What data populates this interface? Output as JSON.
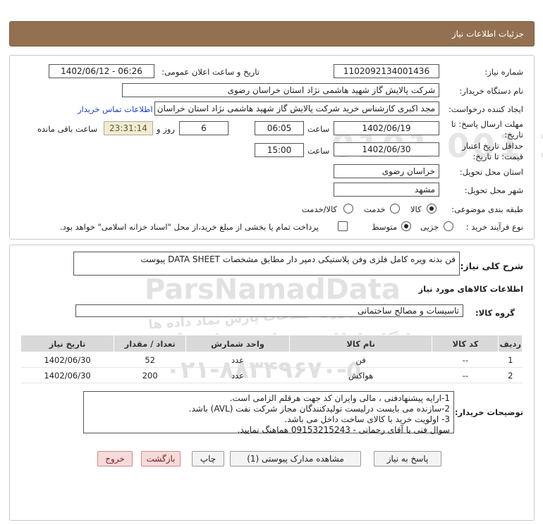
{
  "header": {
    "title": "جزئیات اطلاعات نیاز"
  },
  "need_number": {
    "label": "شماره نیاز:",
    "value": "1102092134001436"
  },
  "announce_datetime": {
    "label": "تاریخ و ساعت اعلان عمومی:",
    "value": "1402/06/12 - 06:26"
  },
  "buyer_org": {
    "label": "نام دستگاه خریدار:",
    "value": "شرکت پالایش گاز شهید هاشمی نژاد   استان خراسان رضوی"
  },
  "requester": {
    "label": "ایجاد کننده درخواست:",
    "value": "مجد اکبری کارشناس خرید شرکت پالایش گاز شهید هاشمی نژاد   استان خراسان رضوی",
    "contact_link": "اطلاعات تماس خریدار"
  },
  "reply_deadline": {
    "label_line1": "مهلت ارسال پاسخ: تا",
    "label_line2": "تاریخ:",
    "date": "1402/06/19",
    "time_label": "ساعت",
    "time": "06:05",
    "days": "6",
    "days_label": "روز و",
    "remaining": "23:31:14",
    "remaining_label": "ساعت باقی مانده"
  },
  "price_validity": {
    "label_line1": "حداقل تاریخ اعتبار",
    "label_line2": "قیمت: تا تاریخ:",
    "date": "1402/06/30",
    "time_label": "ساعت",
    "time": "15:00"
  },
  "delivery_province": {
    "label": "استان محل تحویل:",
    "value": "خراسان رضوی"
  },
  "delivery_city": {
    "label": "شهر محل تحویل:",
    "value": "مشهد"
  },
  "category": {
    "label": "طبقه بندی موضوعی:",
    "options": [
      "کالا",
      "خدمت",
      "کالا/خدمت"
    ],
    "selected": "کالا"
  },
  "purchase_process": {
    "label": "نوع فرآیند خرید :",
    "options": [
      "جزیی",
      "متوسط"
    ],
    "selected": "متوسط",
    "treasury_note": "پرداخت تمام یا بخشی از مبلغ خرید،از محل \"اسناد خزانه اسلامی\" خواهد بود."
  },
  "general_description": {
    "label": "شرح کلی نیاز:",
    "value": "فن بدنه ویره کامل  فلزی وفن پلاستیکی دمپر دار مطابق مشخصات DATA SHEET پیوست"
  },
  "goods_section": {
    "title": "اطلاعات کالاهای مورد نیاز",
    "group_label": "گروه کالا:",
    "group_value": "تاسیسات و مصالح ساختمانی"
  },
  "items_table": {
    "columns": [
      "ردیف",
      "کد کالا",
      "نام کالا",
      "واحد شمارش",
      "تعداد / مقدار",
      "تاریخ نیاز"
    ],
    "rows": [
      [
        "1",
        "--",
        "فن",
        "عدد",
        "52",
        "1402/06/30"
      ],
      [
        "2",
        "--",
        "هواکش",
        "عدد",
        "200",
        "1402/06/30"
      ]
    ]
  },
  "buyer_notes": {
    "label": "توضیحات خریدار:",
    "lines": [
      "1-ارایه پیشنهادفنی ، مالی وایران کد جهت هرقلم الزامی است.",
      "2-سازنده می بایست درلیست تولیدکنندگان مجاز شرکت نفت (AVL)  باشد.",
      "3- اولویت خرید  با کالای ساخت  داخل می باشد.",
      "سوال فنی با آقای رحمانی - 09153215243 هماهنگ نمایید."
    ]
  },
  "buttons": {
    "reply": "پاسخ به نیاز",
    "attachments": "مشاهده مدارک پیوستی (1)",
    "print": "چاپ",
    "back": "بازگشت",
    "exit": "خروج"
  },
  "watermark": {
    "brand": "ParsNamadData",
    "line1": "پایگاه اطلاع رسانی مناقصات",
    "line2": "مرکز فراوری اطلاعات پارس نماد داده ها",
    "phone": "۰۲۱-۸۸۳۴۹۶۷۰-۵",
    "phone_latin": "0101 001 10"
  },
  "colors": {
    "header_bg": "#93704f",
    "link": "#1c3fc5",
    "timer_bg": "#f1eccb"
  }
}
